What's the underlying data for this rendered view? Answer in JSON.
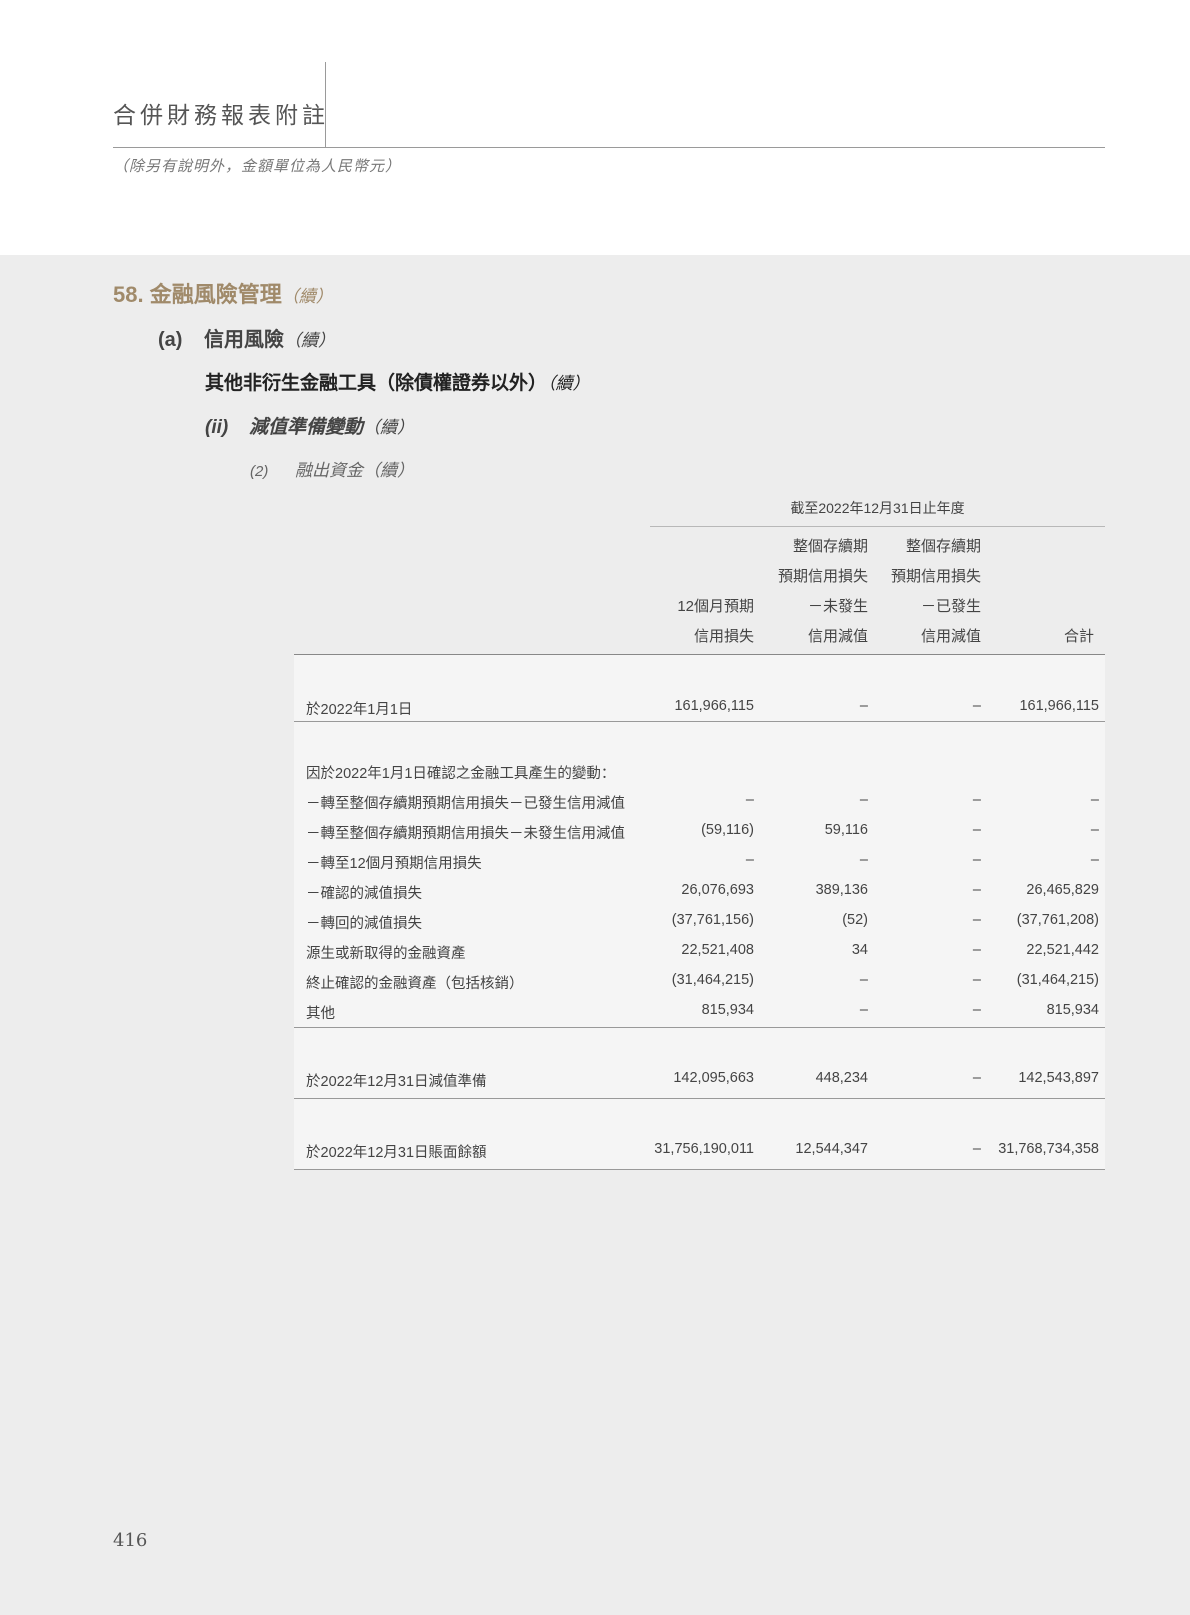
{
  "header": {
    "title": "合併財務報表附註",
    "subtitle": "（除另有說明外，金額單位為人民幣元）"
  },
  "section": {
    "number": "58.",
    "title": "金融風險管理",
    "continued": "（續）"
  },
  "subsection": {
    "label": "(a)",
    "title": "信用風險",
    "continued": "（續）"
  },
  "subheading": {
    "title": "其他非衍生金融工具（除債權證券以外）",
    "continued": "（續）"
  },
  "item": {
    "label": "(ii)",
    "title": "減值準備變動",
    "continued": "（續）"
  },
  "subitem": {
    "label": "(2)",
    "title": "融出資金（續）"
  },
  "table": {
    "period_header": "截至2022年12月31日止年度",
    "columns": [
      {
        "lines": [
          "",
          "",
          "12個月預期",
          "信用損失"
        ]
      },
      {
        "lines": [
          "整個存續期",
          "預期信用損失",
          "－未發生",
          "信用減值"
        ]
      },
      {
        "lines": [
          "整個存續期",
          "預期信用損失",
          "－已發生",
          "信用減值"
        ]
      },
      {
        "lines": [
          "",
          "",
          "",
          "合計"
        ]
      }
    ],
    "opening": {
      "label": "於2022年1月1日",
      "values": [
        "161,966,115",
        "–",
        "–",
        "161,966,115"
      ]
    },
    "changes_heading": "因於2022年1月1日確認之金融工具產生的變動：",
    "changes": [
      {
        "label": "－轉至整個存續期預期信用損失－已發生信用減值",
        "values": [
          "–",
          "–",
          "–",
          "–"
        ]
      },
      {
        "label": "－轉至整個存續期預期信用損失－未發生信用減值",
        "values": [
          "(59,116)",
          "59,116",
          "–",
          "–"
        ]
      },
      {
        "label": "－轉至12個月預期信用損失",
        "values": [
          "–",
          "–",
          "–",
          "–"
        ]
      },
      {
        "label": "－確認的減值損失",
        "values": [
          "26,076,693",
          "389,136",
          "–",
          "26,465,829"
        ]
      },
      {
        "label": "－轉回的減值損失",
        "values": [
          "(37,761,156)",
          "(52)",
          "–",
          "(37,761,208)"
        ]
      },
      {
        "label": "源生或新取得的金融資產",
        "values": [
          "22,521,408",
          "34",
          "–",
          "22,521,442"
        ]
      },
      {
        "label": "終止確認的金融資產（包括核銷）",
        "values": [
          "(31,464,215)",
          "–",
          "–",
          "(31,464,215)"
        ]
      },
      {
        "label": "其他",
        "values": [
          "815,934",
          "–",
          "–",
          "815,934"
        ]
      }
    ],
    "closing_allowance": {
      "label": "於2022年12月31日減值準備",
      "values": [
        "142,095,663",
        "448,234",
        "–",
        "142,543,897"
      ]
    },
    "carrying_amount": {
      "label": "於2022年12月31日賬面餘額",
      "values": [
        "31,756,190,011",
        "12,544,347",
        "–",
        "31,768,734,358"
      ]
    }
  },
  "page_number": "416"
}
